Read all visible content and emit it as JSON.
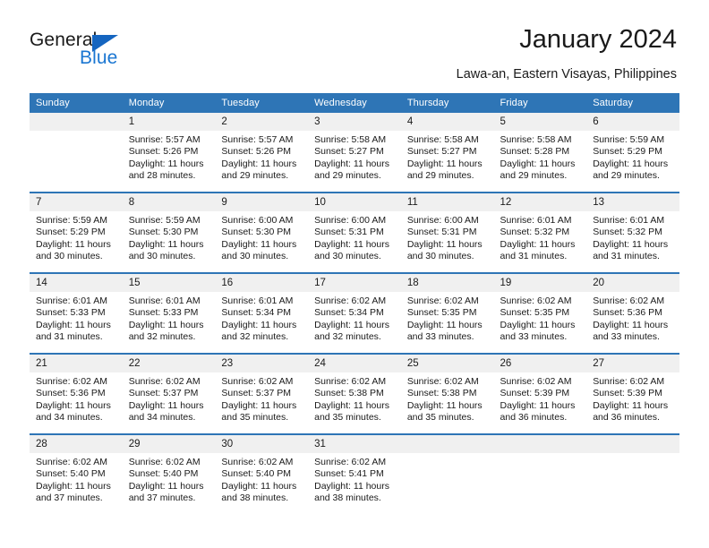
{
  "brand": {
    "name_part1": "General",
    "name_part2": "Blue",
    "accent_color": "#1A76D2",
    "triangle_color": "#1565C0"
  },
  "header": {
    "title": "January 2024",
    "subtitle": "Lawa-an, Eastern Visayas, Philippines",
    "header_bg_color": "#2E75B6",
    "daynum_bg_color": "#F0F0F0"
  },
  "calendar": {
    "weekday_headers": [
      "Sunday",
      "Monday",
      "Tuesday",
      "Wednesday",
      "Thursday",
      "Friday",
      "Saturday"
    ],
    "weeks": [
      [
        {
          "day": "",
          "sunrise": "",
          "sunset": "",
          "daylight": ""
        },
        {
          "day": "1",
          "sunrise": "Sunrise: 5:57 AM",
          "sunset": "Sunset: 5:26 PM",
          "daylight": "Daylight: 11 hours and 28 minutes."
        },
        {
          "day": "2",
          "sunrise": "Sunrise: 5:57 AM",
          "sunset": "Sunset: 5:26 PM",
          "daylight": "Daylight: 11 hours and 29 minutes."
        },
        {
          "day": "3",
          "sunrise": "Sunrise: 5:58 AM",
          "sunset": "Sunset: 5:27 PM",
          "daylight": "Daylight: 11 hours and 29 minutes."
        },
        {
          "day": "4",
          "sunrise": "Sunrise: 5:58 AM",
          "sunset": "Sunset: 5:27 PM",
          "daylight": "Daylight: 11 hours and 29 minutes."
        },
        {
          "day": "5",
          "sunrise": "Sunrise: 5:58 AM",
          "sunset": "Sunset: 5:28 PM",
          "daylight": "Daylight: 11 hours and 29 minutes."
        },
        {
          "day": "6",
          "sunrise": "Sunrise: 5:59 AM",
          "sunset": "Sunset: 5:29 PM",
          "daylight": "Daylight: 11 hours and 29 minutes."
        }
      ],
      [
        {
          "day": "7",
          "sunrise": "Sunrise: 5:59 AM",
          "sunset": "Sunset: 5:29 PM",
          "daylight": "Daylight: 11 hours and 30 minutes."
        },
        {
          "day": "8",
          "sunrise": "Sunrise: 5:59 AM",
          "sunset": "Sunset: 5:30 PM",
          "daylight": "Daylight: 11 hours and 30 minutes."
        },
        {
          "day": "9",
          "sunrise": "Sunrise: 6:00 AM",
          "sunset": "Sunset: 5:30 PM",
          "daylight": "Daylight: 11 hours and 30 minutes."
        },
        {
          "day": "10",
          "sunrise": "Sunrise: 6:00 AM",
          "sunset": "Sunset: 5:31 PM",
          "daylight": "Daylight: 11 hours and 30 minutes."
        },
        {
          "day": "11",
          "sunrise": "Sunrise: 6:00 AM",
          "sunset": "Sunset: 5:31 PM",
          "daylight": "Daylight: 11 hours and 30 minutes."
        },
        {
          "day": "12",
          "sunrise": "Sunrise: 6:01 AM",
          "sunset": "Sunset: 5:32 PM",
          "daylight": "Daylight: 11 hours and 31 minutes."
        },
        {
          "day": "13",
          "sunrise": "Sunrise: 6:01 AM",
          "sunset": "Sunset: 5:32 PM",
          "daylight": "Daylight: 11 hours and 31 minutes."
        }
      ],
      [
        {
          "day": "14",
          "sunrise": "Sunrise: 6:01 AM",
          "sunset": "Sunset: 5:33 PM",
          "daylight": "Daylight: 11 hours and 31 minutes."
        },
        {
          "day": "15",
          "sunrise": "Sunrise: 6:01 AM",
          "sunset": "Sunset: 5:33 PM",
          "daylight": "Daylight: 11 hours and 32 minutes."
        },
        {
          "day": "16",
          "sunrise": "Sunrise: 6:01 AM",
          "sunset": "Sunset: 5:34 PM",
          "daylight": "Daylight: 11 hours and 32 minutes."
        },
        {
          "day": "17",
          "sunrise": "Sunrise: 6:02 AM",
          "sunset": "Sunset: 5:34 PM",
          "daylight": "Daylight: 11 hours and 32 minutes."
        },
        {
          "day": "18",
          "sunrise": "Sunrise: 6:02 AM",
          "sunset": "Sunset: 5:35 PM",
          "daylight": "Daylight: 11 hours and 33 minutes."
        },
        {
          "day": "19",
          "sunrise": "Sunrise: 6:02 AM",
          "sunset": "Sunset: 5:35 PM",
          "daylight": "Daylight: 11 hours and 33 minutes."
        },
        {
          "day": "20",
          "sunrise": "Sunrise: 6:02 AM",
          "sunset": "Sunset: 5:36 PM",
          "daylight": "Daylight: 11 hours and 33 minutes."
        }
      ],
      [
        {
          "day": "21",
          "sunrise": "Sunrise: 6:02 AM",
          "sunset": "Sunset: 5:36 PM",
          "daylight": "Daylight: 11 hours and 34 minutes."
        },
        {
          "day": "22",
          "sunrise": "Sunrise: 6:02 AM",
          "sunset": "Sunset: 5:37 PM",
          "daylight": "Daylight: 11 hours and 34 minutes."
        },
        {
          "day": "23",
          "sunrise": "Sunrise: 6:02 AM",
          "sunset": "Sunset: 5:37 PM",
          "daylight": "Daylight: 11 hours and 35 minutes."
        },
        {
          "day": "24",
          "sunrise": "Sunrise: 6:02 AM",
          "sunset": "Sunset: 5:38 PM",
          "daylight": "Daylight: 11 hours and 35 minutes."
        },
        {
          "day": "25",
          "sunrise": "Sunrise: 6:02 AM",
          "sunset": "Sunset: 5:38 PM",
          "daylight": "Daylight: 11 hours and 35 minutes."
        },
        {
          "day": "26",
          "sunrise": "Sunrise: 6:02 AM",
          "sunset": "Sunset: 5:39 PM",
          "daylight": "Daylight: 11 hours and 36 minutes."
        },
        {
          "day": "27",
          "sunrise": "Sunrise: 6:02 AM",
          "sunset": "Sunset: 5:39 PM",
          "daylight": "Daylight: 11 hours and 36 minutes."
        }
      ],
      [
        {
          "day": "28",
          "sunrise": "Sunrise: 6:02 AM",
          "sunset": "Sunset: 5:40 PM",
          "daylight": "Daylight: 11 hours and 37 minutes."
        },
        {
          "day": "29",
          "sunrise": "Sunrise: 6:02 AM",
          "sunset": "Sunset: 5:40 PM",
          "daylight": "Daylight: 11 hours and 37 minutes."
        },
        {
          "day": "30",
          "sunrise": "Sunrise: 6:02 AM",
          "sunset": "Sunset: 5:40 PM",
          "daylight": "Daylight: 11 hours and 38 minutes."
        },
        {
          "day": "31",
          "sunrise": "Sunrise: 6:02 AM",
          "sunset": "Sunset: 5:41 PM",
          "daylight": "Daylight: 11 hours and 38 minutes."
        },
        {
          "day": "",
          "sunrise": "",
          "sunset": "",
          "daylight": ""
        },
        {
          "day": "",
          "sunrise": "",
          "sunset": "",
          "daylight": ""
        },
        {
          "day": "",
          "sunrise": "",
          "sunset": "",
          "daylight": ""
        }
      ]
    ]
  }
}
